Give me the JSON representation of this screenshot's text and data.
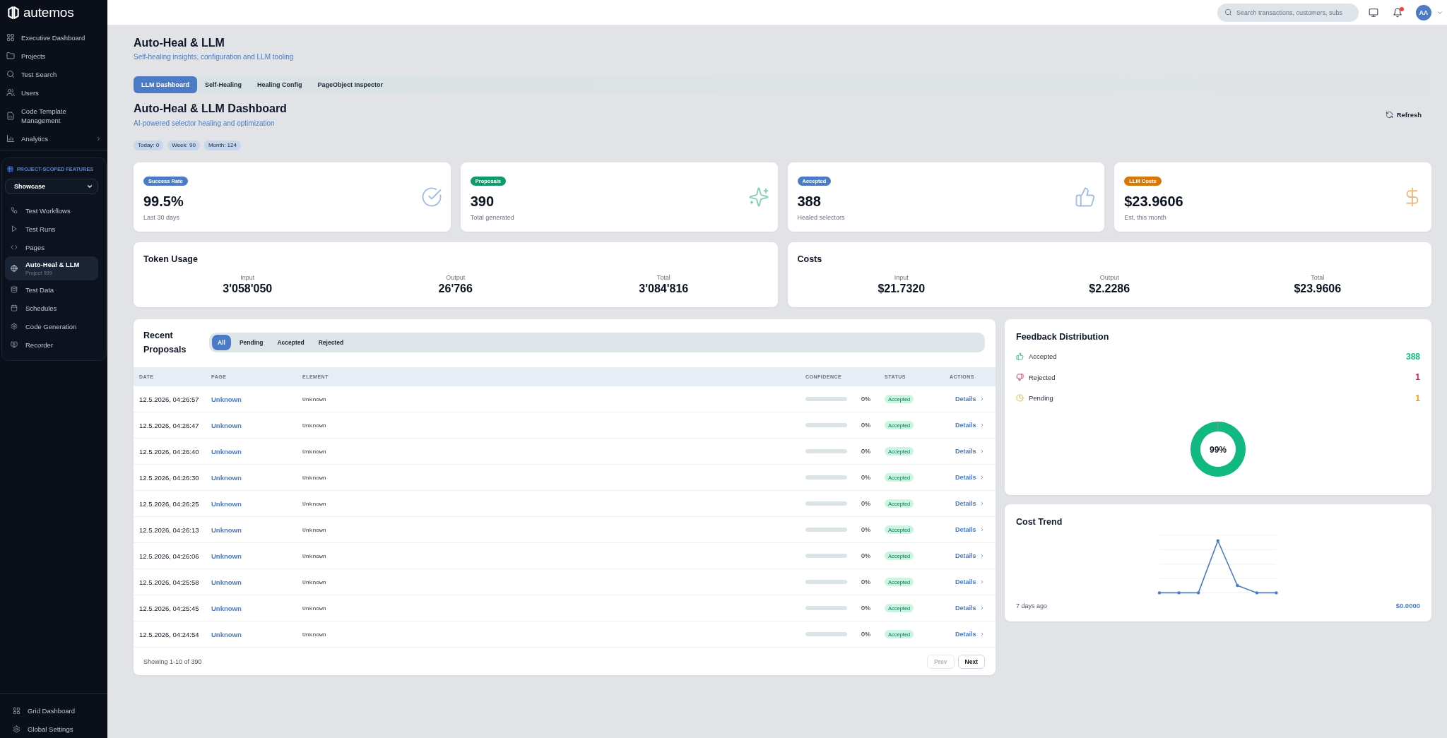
{
  "sidebar": {
    "logo": "autemos",
    "nav": [
      {
        "label": "Executive Dashboard",
        "selected": false
      },
      {
        "label": "Projects",
        "selected": false
      },
      {
        "label": "Test Search",
        "selected": false
      },
      {
        "label": "Users",
        "selected": false
      },
      {
        "label": "Code Template Management",
        "selected": false
      },
      {
        "label": "Analytics",
        "selected": false,
        "expanded": false
      }
    ],
    "project_section": {
      "heading": "PROJECT-SCOPED FEATURES",
      "project_select": {
        "value": "Showcase"
      },
      "items": [
        {
          "label": "Test Workflows",
          "selected": false
        },
        {
          "label": "Test Runs",
          "selected": false
        },
        {
          "label": "Pages",
          "selected": false
        },
        {
          "label": "Auto-Heal & LLM",
          "subtitle": "Project 999",
          "selected": true
        },
        {
          "label": "Test Data",
          "selected": false
        },
        {
          "label": "Schedules",
          "selected": false
        },
        {
          "label": "Code Generation",
          "selected": false
        },
        {
          "label": "Recorder",
          "selected": false
        }
      ]
    },
    "footer": [
      {
        "label": "Grid Dashboard",
        "selected": false
      },
      {
        "label": "Global Settings",
        "selected": false
      }
    ]
  },
  "top_bar": {
    "search": {
      "placeholder": "Search transactions, customers, subs"
    },
    "notifications": {
      "unread": true
    },
    "avatar": {
      "initials": "AA"
    }
  },
  "page_header": {
    "title": "Auto-Heal & LLM",
    "subtitle": "Self-healing insights, configuration and LLM tooling"
  },
  "tabs": [
    {
      "label": "LLM Dashboard",
      "selected": true
    },
    {
      "label": "Self-Healing",
      "selected": false
    },
    {
      "label": "Healing Config",
      "selected": false
    },
    {
      "label": "PageObject Inspector",
      "selected": false
    }
  ],
  "dashboard": {
    "title": "Auto-Heal & LLM Dashboard",
    "subtitle": "AI-powered selector healing and optimization",
    "refresh_button": "Refresh",
    "counters": [
      "Today: 0",
      "Week: 90",
      "Month: 124"
    ]
  },
  "stat_cards": [
    {
      "badge": "Success Rate",
      "color": "#4a7bc4",
      "value": "99.5%",
      "caption": "Last 30 days"
    },
    {
      "badge": "Proposals",
      "color": "#0e9a6b",
      "value": "390",
      "caption": "Total generated"
    },
    {
      "badge": "Accepted",
      "color": "#4a7bc4",
      "value": "388",
      "caption": "Healed selectors"
    },
    {
      "badge": "LLM Costs",
      "color": "#d97706",
      "value": "$23.9606",
      "caption": "Est. this month"
    }
  ],
  "token_usage": {
    "title": "Token Usage",
    "metrics": [
      {
        "label": "Input",
        "value": "3'058'050"
      },
      {
        "label": "Output",
        "value": "26'766"
      },
      {
        "label": "Total",
        "value": "3'084'816"
      }
    ]
  },
  "costs": {
    "title": "Costs",
    "metrics": [
      {
        "label": "Input",
        "value": "$21.7320"
      },
      {
        "label": "Output",
        "value": "$2.2286"
      },
      {
        "label": "Total",
        "value": "$23.9606"
      }
    ]
  },
  "recent_proposals": {
    "title": "Recent Proposals",
    "filters": [
      {
        "label": "All",
        "selected": true
      },
      {
        "label": "Pending",
        "selected": false
      },
      {
        "label": "Accepted",
        "selected": false
      },
      {
        "label": "Rejected",
        "selected": false
      }
    ],
    "table": {
      "columns": [
        "DATE",
        "PAGE",
        "ELEMENT",
        "CONFIDENCE",
        "STATUS",
        "ACTIONS"
      ],
      "rows": [
        {
          "date": "12.5.2026, 04:26:57",
          "page": "Unknown",
          "element": "Unknown",
          "confidence": {
            "level": 0,
            "reading": "0%"
          },
          "status": "Accepted",
          "action": "Details"
        },
        {
          "date": "12.5.2026, 04:26:47",
          "page": "Unknown",
          "element": "Unknown",
          "confidence": {
            "level": 0,
            "reading": "0%"
          },
          "status": "Accepted",
          "action": "Details"
        },
        {
          "date": "12.5.2026, 04:26:40",
          "page": "Unknown",
          "element": "Unknown",
          "confidence": {
            "level": 0,
            "reading": "0%"
          },
          "status": "Accepted",
          "action": "Details"
        },
        {
          "date": "12.5.2026, 04:26:30",
          "page": "Unknown",
          "element": "Unknown",
          "confidence": {
            "level": 0,
            "reading": "0%"
          },
          "status": "Accepted",
          "action": "Details"
        },
        {
          "date": "12.5.2026, 04:26:25",
          "page": "Unknown",
          "element": "Unknown",
          "confidence": {
            "level": 0,
            "reading": "0%"
          },
          "status": "Accepted",
          "action": "Details"
        },
        {
          "date": "12.5.2026, 04:26:13",
          "page": "Unknown",
          "element": "Unknown",
          "confidence": {
            "level": 0,
            "reading": "0%"
          },
          "status": "Accepted",
          "action": "Details"
        },
        {
          "date": "12.5.2026, 04:26:06",
          "page": "Unknown",
          "element": "Unknown",
          "confidence": {
            "level": 0,
            "reading": "0%"
          },
          "status": "Accepted",
          "action": "Details"
        },
        {
          "date": "12.5.2026, 04:25:58",
          "page": "Unknown",
          "element": "Unknown",
          "confidence": {
            "level": 0,
            "reading": "0%"
          },
          "status": "Accepted",
          "action": "Details"
        },
        {
          "date": "12.5.2026, 04:25:45",
          "page": "Unknown",
          "element": "Unknown",
          "confidence": {
            "level": 0,
            "reading": "0%"
          },
          "status": "Accepted",
          "action": "Details"
        },
        {
          "date": "12.5.2026, 04:24:54",
          "page": "Unknown",
          "element": "Unknown",
          "confidence": {
            "level": 0,
            "reading": "0%"
          },
          "status": "Accepted",
          "action": "Details"
        }
      ]
    },
    "footer": {
      "summary": "Showing 1-10 of 390",
      "pagination": [
        {
          "label": "Prev",
          "disabled": true
        },
        {
          "label": "Next",
          "disabled": false
        }
      ]
    }
  },
  "feedback_distribution": {
    "title": "Feedback Distribution",
    "items": [
      {
        "label": "Accepted",
        "count": "388",
        "color": "#10b981"
      },
      {
        "label": "Rejected",
        "count": "1",
        "color": "#e11d48"
      },
      {
        "label": "Pending",
        "count": "1",
        "color": "#f59e0b"
      }
    ],
    "chart_data": {
      "type": "donut",
      "values": [
        99.74,
        0.26
      ]
    },
    "center_label": "99%"
  },
  "cost_trend": {
    "title": "Cost Trend",
    "range_start": "7 days ago",
    "latest_value": "$0.0000"
  }
}
